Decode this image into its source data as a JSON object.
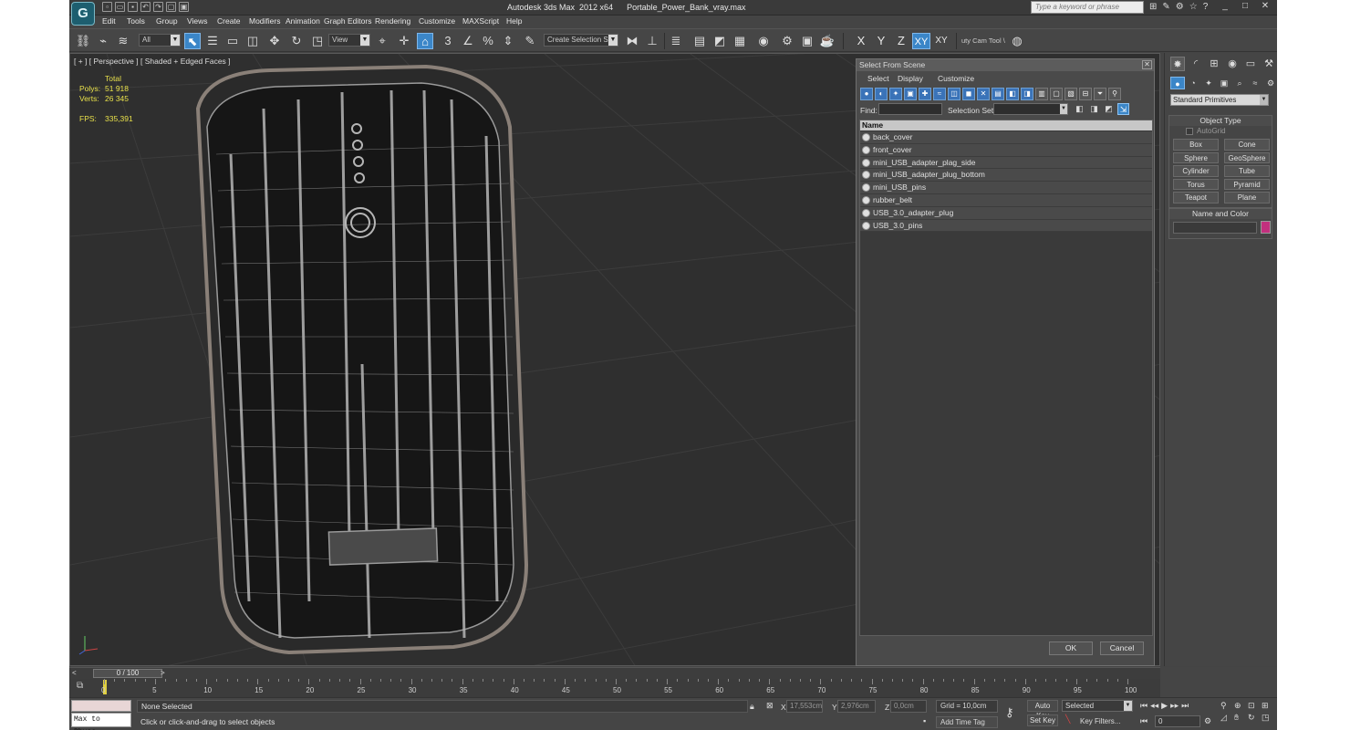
{
  "app": {
    "logo": "G",
    "title": "Autodesk 3ds Max  2012 x64      Portable_Power_Bank_vray.max",
    "search_placeholder": "Type a keyword or phrase",
    "window_buttons": [
      "_",
      "□",
      "✕"
    ]
  },
  "menu": [
    "Edit",
    "Tools",
    "Group",
    "Views",
    "Create",
    "Modifiers",
    "Animation",
    "Graph Editors",
    "Rendering",
    "Customize",
    "MAXScript",
    "Help"
  ],
  "toolbar": {
    "filter_value": "All",
    "ref_coord_value": "View",
    "selection_set_value": "Create Selection Se",
    "snap_label": "3",
    "axis_x": "X",
    "axis_y": "Y",
    "axis_z": "Z",
    "axis_xy": "XY",
    "axis_xy2": "XY",
    "extra_tool_label": "uty Cam Tool \\"
  },
  "viewport": {
    "label": "[ + ] [ Perspective ] [ Shaded + Edged Faces ]",
    "stats": {
      "total_label": "Total",
      "polys_label": "Polys:",
      "polys_value": "51 918",
      "verts_label": "Verts:",
      "verts_value": "26 345",
      "fps_label": "FPS:",
      "fps_value": "335,391"
    }
  },
  "dialog": {
    "title": "Select From Scene",
    "menus": [
      "Select",
      "Display",
      "Customize"
    ],
    "find_label": "Find:",
    "selection_set_label": "Selection Set:",
    "column_header": "Name",
    "objects": [
      "back_cover",
      "front_cover",
      "mini_USB_adapter_plag_side",
      "mini_USB_adapter_plug_bottom",
      "mini_USB_pins",
      "rubber_belt",
      "USB_3.0_adapter_plug",
      "USB_3.0_pins"
    ],
    "ok_label": "OK",
    "cancel_label": "Cancel"
  },
  "command_panel": {
    "category_value": "Standard Primitives",
    "object_type_title": "Object Type",
    "autogrid_label": "AutoGrid",
    "primitives": [
      "Box",
      "Cone",
      "Sphere",
      "GeoSphere",
      "Cylinder",
      "Tube",
      "Torus",
      "Pyramid",
      "Teapot",
      "Plane"
    ],
    "name_color_title": "Name and Color",
    "object_color": "#c2307e"
  },
  "timeline": {
    "frame_display": "0 / 100",
    "prev": "<",
    "next": ">",
    "ticks": [
      "0",
      "5",
      "10",
      "15",
      "20",
      "25",
      "30",
      "35",
      "40",
      "45",
      "50",
      "55",
      "60",
      "65",
      "70",
      "75",
      "80",
      "85",
      "90",
      "95",
      "100"
    ]
  },
  "status": {
    "maxscript_label": "Max to Physc.",
    "selection_status": "None Selected",
    "prompt": "Click or click-and-drag to select objects",
    "x_label": "X:",
    "x_value": "17,553cm",
    "y_label": "Y:",
    "y_value": "2,976cm",
    "z_label": "Z:",
    "z_value": "0,0cm",
    "grid": "Grid = 10,0cm",
    "add_time_tag": "Add Time Tag",
    "auto_key": "Auto Key",
    "set_key": "Set Key",
    "key_mode_value": "Selected",
    "key_filters": "Key Filters...",
    "current_frame": "0"
  },
  "colors": {
    "accent_blue": "#3b86c8",
    "stats_yellow": "#e8e04a",
    "viewport_bg": "#2f2f2f"
  }
}
